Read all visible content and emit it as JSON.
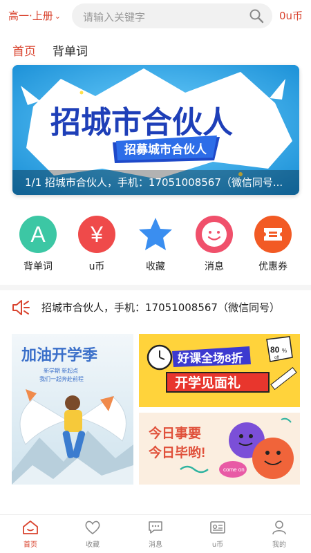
{
  "header": {
    "grade_selector": "高一·上册",
    "search_placeholder": "请输入关键字",
    "coins": "0u币"
  },
  "tabs": [
    {
      "label": "首页",
      "active": true
    },
    {
      "label": "背单词",
      "active": false
    }
  ],
  "banner": {
    "image_text_main": "招城市合伙人",
    "image_text_ribbon": "招募城市合伙人",
    "caption": "1/1 招城市合伙人，手机：17051008567（微信同号..."
  },
  "quick_actions": [
    {
      "label": "背单词",
      "glyph": "A",
      "icon": "letter-a-icon",
      "color": "#3cc7a4"
    },
    {
      "label": "u币",
      "glyph": "¥",
      "icon": "yen-icon",
      "color": "#ef4a4a"
    },
    {
      "label": "收藏",
      "glyph": "★",
      "icon": "star-icon",
      "color": "#3a8ef0"
    },
    {
      "label": "消息",
      "glyph": "",
      "icon": "smile-icon",
      "color": "#f0506b"
    },
    {
      "label": "优惠券",
      "glyph": "",
      "icon": "coupon-icon",
      "color": "#f25a24"
    }
  ],
  "notice": {
    "icon": "speaker-icon",
    "text": "招城市合伙人，手机：17051008567（微信同号）"
  },
  "promos": {
    "left": {
      "title": "加油开学季",
      "line1": "新学期 新起点",
      "line2": "我们一起奔赴前程"
    },
    "right_top": {
      "title1": "好课全场8折",
      "badge": "80",
      "badge_unit": "%",
      "badge_off": "off",
      "title2": "开学见面礼"
    },
    "right_bottom": {
      "line1": "今日事要",
      "line2": "今日毕哟!",
      "bubble": "come on"
    }
  },
  "bottom_nav": [
    {
      "label": "首页",
      "icon": "home-icon",
      "active": true
    },
    {
      "label": "收藏",
      "icon": "heart-icon",
      "active": false
    },
    {
      "label": "消息",
      "icon": "chat-icon",
      "active": false
    },
    {
      "label": "u币",
      "icon": "card-icon",
      "active": false
    },
    {
      "label": "我的",
      "icon": "user-icon",
      "active": false
    }
  ],
  "colors": {
    "accent": "#d9432e",
    "banner_blue": "#27a8e8"
  }
}
